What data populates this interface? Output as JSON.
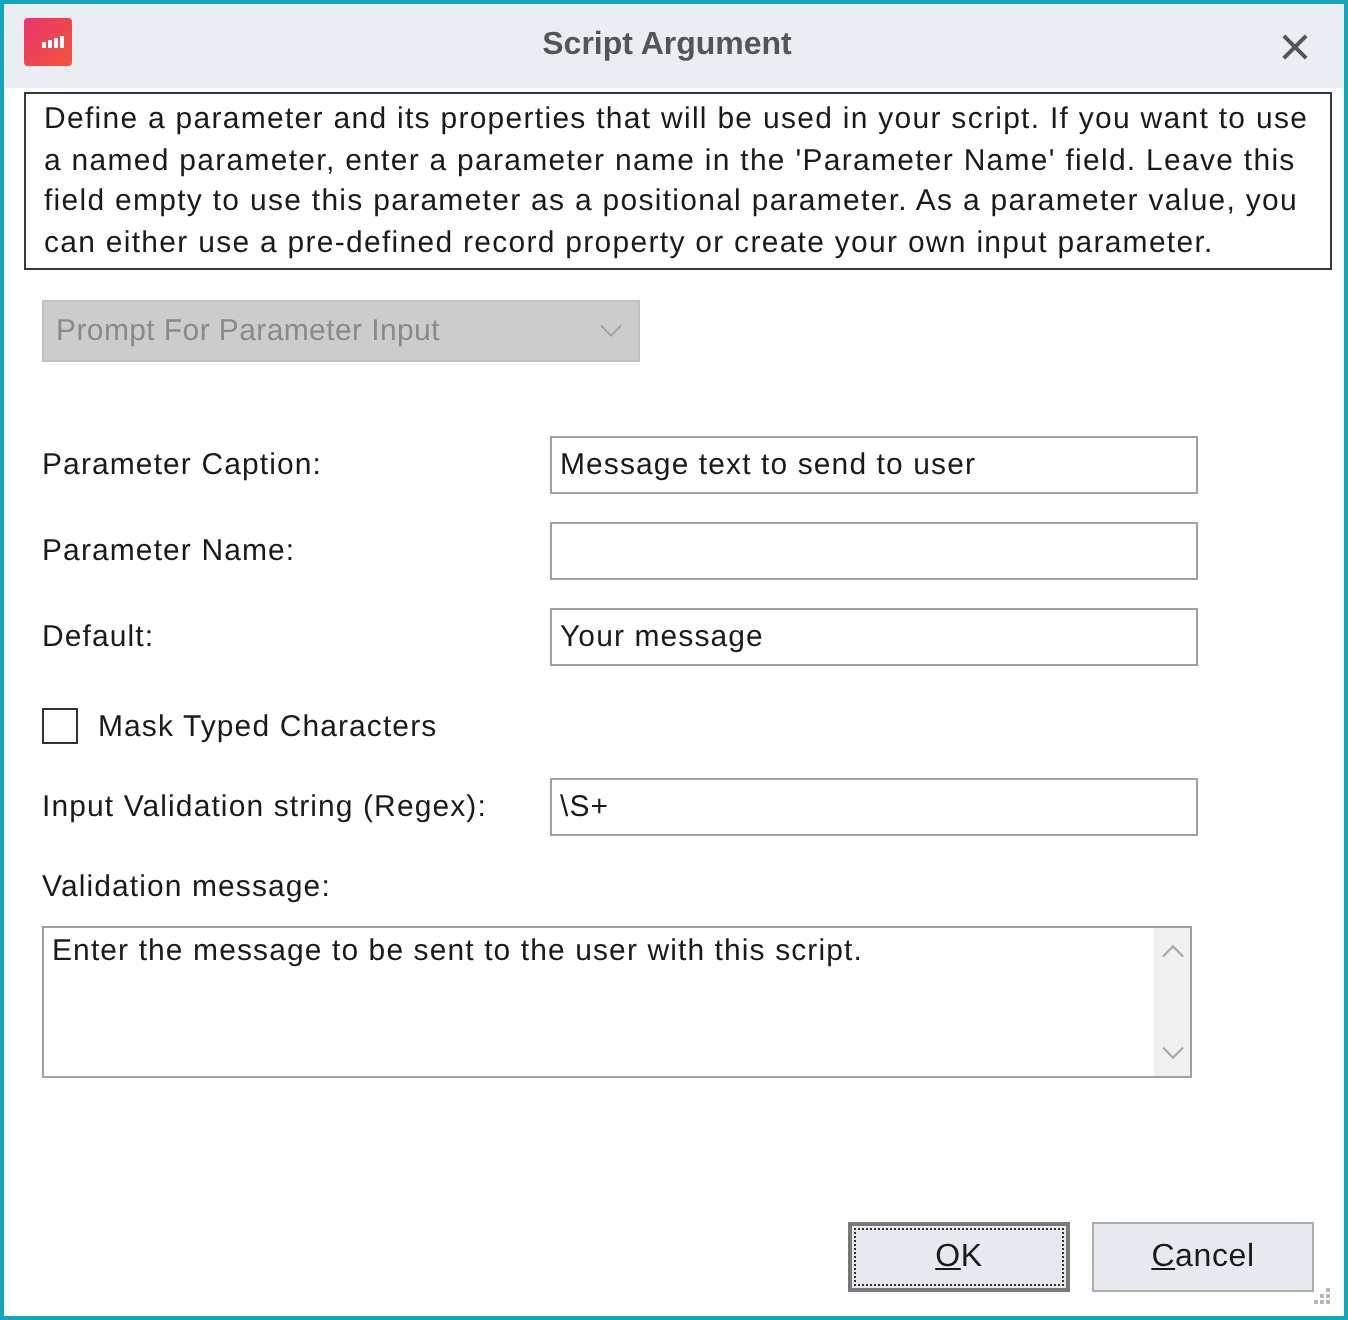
{
  "window": {
    "title": "Script Argument"
  },
  "description": "Define a parameter and its properties that will be used in your script. If you want to use a named parameter, enter a parameter name in the 'Parameter Name' field. Leave this field empty to use this parameter as a positional parameter. As a parameter value, you can either use a pre-defined record property or create your own input parameter.",
  "source_dropdown": {
    "value": "Prompt For Parameter Input",
    "disabled": true
  },
  "fields": [
    {
      "kind": "text",
      "label": "Parameter Caption:",
      "value": "Message text to send to user"
    },
    {
      "kind": "text",
      "label": "Parameter Name:"
    },
    {
      "kind": "text",
      "label": "Default:",
      "value": "Your message"
    },
    {
      "kind": "checkbox",
      "label": "Mask Typed Characters",
      "checked": false
    },
    {
      "kind": "text",
      "label": "Input Validation string (Regex):",
      "value": "\\S+"
    },
    {
      "kind": "textarea",
      "label": "Validation message:",
      "value": "Enter the message to be sent to the user with this script."
    }
  ],
  "buttons": [
    {
      "mnemonic": "O",
      "label_rest": "K",
      "default": true
    },
    {
      "mnemonic": "C",
      "label_rest": "ancel",
      "default": false
    }
  ]
}
